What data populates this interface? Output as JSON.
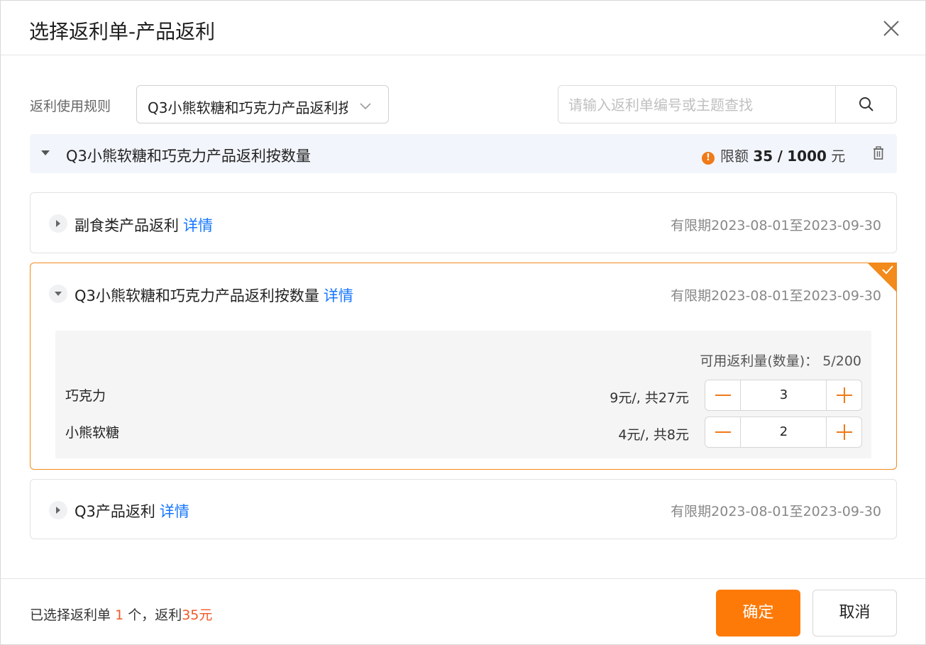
{
  "dialog": {
    "title": "选择返利单-产品返利",
    "close_icon": "close-icon"
  },
  "filter": {
    "rule_label": "返利使用规则",
    "rule_selected": "Q3小熊软糖和巧克力产品返利按数量",
    "search_placeholder": "请输入返利单编号或主题查找",
    "search_value": ""
  },
  "group": {
    "name": "Q3小熊软糖和巧克力产品返利按数量",
    "quota_prefix": "限额",
    "quota_used": "35",
    "quota_sep": "/",
    "quota_total": "1000",
    "quota_unit": "元"
  },
  "cards": [
    {
      "name": "副食类产品返利",
      "detail": "详情",
      "period": "有限期2023-08-01至2023-09-30",
      "expanded": false,
      "selected": false
    },
    {
      "name": "Q3小熊软糖和巧克力产品返利按数量",
      "detail": "详情",
      "period": "有限期2023-08-01至2023-09-30",
      "expanded": true,
      "selected": true,
      "available_label": "可用返利量(数量)：",
      "available_value": "5/200",
      "products": [
        {
          "name": "巧克力",
          "price": "9元/, 共27元",
          "qty": "3"
        },
        {
          "name": "小熊软糖",
          "price": "4元/, 共8元",
          "qty": "2"
        }
      ]
    },
    {
      "name": "Q3产品返利",
      "detail": "详情",
      "period": "有限期2023-08-01至2023-09-30",
      "expanded": false,
      "selected": false
    }
  ],
  "footer": {
    "summary_prefix": "已选择返利单",
    "selected_count": "1",
    "summary_mid": "个，返利",
    "rebate_amount": "35元",
    "confirm_label": "确定",
    "cancel_label": "取消"
  },
  "colors": {
    "accent": "#fd7a08",
    "link": "#1677ff",
    "highlight_red": "#f05a28",
    "group_bg": "#f2f5fb"
  }
}
